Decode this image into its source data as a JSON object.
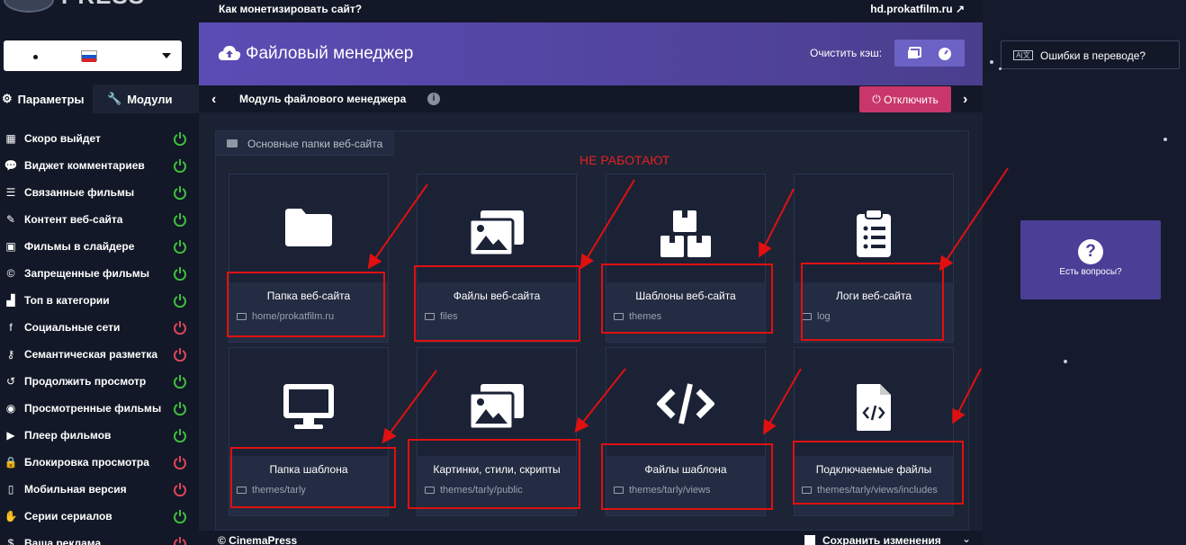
{
  "logo": {
    "text": "PRESS"
  },
  "language": {
    "selected": "•"
  },
  "sidebar_tabs": {
    "params": "Параметры",
    "modules": "Модули"
  },
  "menu": [
    {
      "label": "Скоро выйдет",
      "icon": "calendar-icon",
      "status": "on"
    },
    {
      "label": "Виджет комментариев",
      "icon": "comments-icon",
      "status": "on"
    },
    {
      "label": "Связанные фильмы",
      "icon": "list-icon",
      "status": "on"
    },
    {
      "label": "Контент веб-сайта",
      "icon": "pen-icon",
      "status": "on"
    },
    {
      "label": "Фильмы в слайдере",
      "icon": "images-icon",
      "status": "on"
    },
    {
      "label": "Запрещенные фильмы",
      "icon": "copyright-icon",
      "status": "on"
    },
    {
      "label": "Топ в категории",
      "icon": "chart-icon",
      "status": "on"
    },
    {
      "label": "Социальные сети",
      "icon": "facebook-icon",
      "status": "off"
    },
    {
      "label": "Семантическая разметка",
      "icon": "key-icon",
      "status": "off"
    },
    {
      "label": "Продолжить просмотр",
      "icon": "history-icon",
      "status": "on"
    },
    {
      "label": "Просмотренные фильмы",
      "icon": "eye-icon",
      "status": "on"
    },
    {
      "label": "Плеер фильмов",
      "icon": "play-icon",
      "status": "on"
    },
    {
      "label": "Блокировка просмотра",
      "icon": "lock-icon",
      "status": "off"
    },
    {
      "label": "Мобильная версия",
      "icon": "mobile-icon",
      "status": "off"
    },
    {
      "label": "Серии сериалов",
      "icon": "hand-icon",
      "status": "on"
    },
    {
      "label": "Ваша реклама",
      "icon": "dollar-icon",
      "status": "off"
    }
  ],
  "topbar": {
    "question": "Как монетизировать сайт?",
    "site": "hd.prokatfilm.ru"
  },
  "header": {
    "title": "Файловый менеджер",
    "clear_cache": "Очистить кэш:"
  },
  "subbar": {
    "module": "Модуль файлового менеджера",
    "disable": "Отключить"
  },
  "panel": {
    "title": "Основные папки веб-сайта"
  },
  "annotation": {
    "text": "НЕ РАБОТАЮТ"
  },
  "cards": [
    {
      "name": "Папка веб-сайта",
      "path": "home/prokatfilm.ru",
      "icon": "folder-icon"
    },
    {
      "name": "Файлы веб-сайта",
      "path": "files",
      "icon": "images-icon"
    },
    {
      "name": "Шаблоны веб-сайта",
      "path": "themes",
      "icon": "boxes-icon"
    },
    {
      "name": "Логи веб-сайта",
      "path": "log",
      "icon": "clipboard-list-icon"
    },
    {
      "name": "Папка шаблона",
      "path": "themes/tarly",
      "icon": "desktop-icon"
    },
    {
      "name": "Картинки, стили, скрипты",
      "path": "themes/tarly/public",
      "icon": "images-icon"
    },
    {
      "name": "Файлы шаблона",
      "path": "themes/tarly/views",
      "icon": "code-icon"
    },
    {
      "name": "Подключаемые файлы",
      "path": "themes/tarly/views/includes",
      "icon": "file-code-icon"
    }
  ],
  "footer": {
    "copyright": "© CinemaPress",
    "save": "Сохранить изменения"
  },
  "right": {
    "errors": "Ошибки в переводе?",
    "questions": "Есть вопросы?"
  },
  "colors": {
    "accent": "#5b4cb4",
    "on": "#3fbf3f",
    "off": "#e0465a",
    "highlight": "#e01010"
  }
}
